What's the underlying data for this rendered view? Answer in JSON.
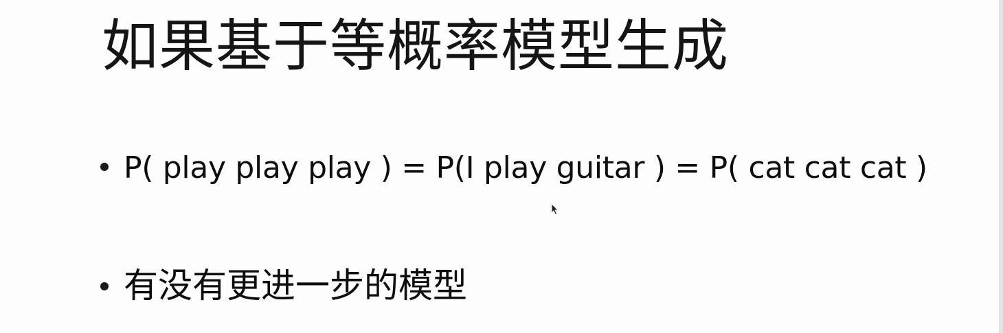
{
  "slide": {
    "title": "如果基于等概率模型生成",
    "bullets": [
      {
        "text": "P( play play play ) = P(I play guitar ) = P( cat cat cat )"
      },
      {
        "text": "有没有更进一步的模型"
      }
    ]
  },
  "icons": {
    "bullet": "bullet-dot-icon",
    "cursor": "mouse-pointer-icon"
  },
  "colors": {
    "background": "#fdfdfd",
    "text": "#111111"
  }
}
